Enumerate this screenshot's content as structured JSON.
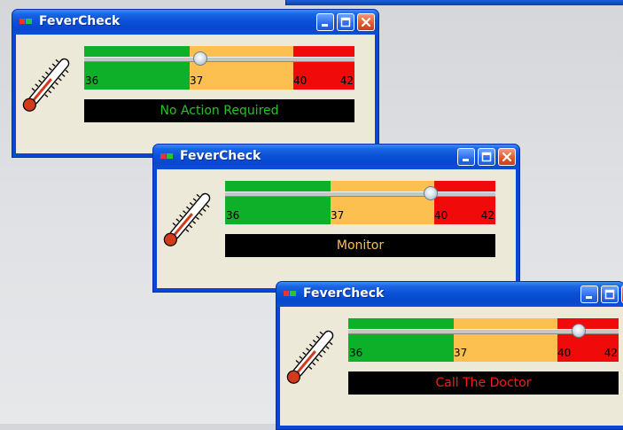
{
  "app": {
    "title": "FeverCheck"
  },
  "scale": {
    "min": 36,
    "max": 42,
    "tick_labels": [
      "36",
      "37",
      "40",
      "42"
    ],
    "zones": [
      {
        "name": "normal",
        "color": "#0eb02a"
      },
      {
        "name": "monitor",
        "color": "#fcc050"
      },
      {
        "name": "doctor",
        "color": "#f00a0a"
      }
    ]
  },
  "windows": [
    {
      "temperature": 37.3,
      "status_text": "No Action Required",
      "status_color": "#27c227"
    },
    {
      "temperature": 39.9,
      "status_text": "Monitor",
      "status_color": "#fcc050"
    },
    {
      "temperature": 40.7,
      "status_text": "Call The Doctor",
      "status_color": "#ff1a1a"
    }
  ],
  "icons": {
    "app": "app-icon",
    "minimize": "minimize-icon",
    "maximize": "maximize-icon",
    "close": "close-icon",
    "thermometer": "thermometer-icon"
  }
}
